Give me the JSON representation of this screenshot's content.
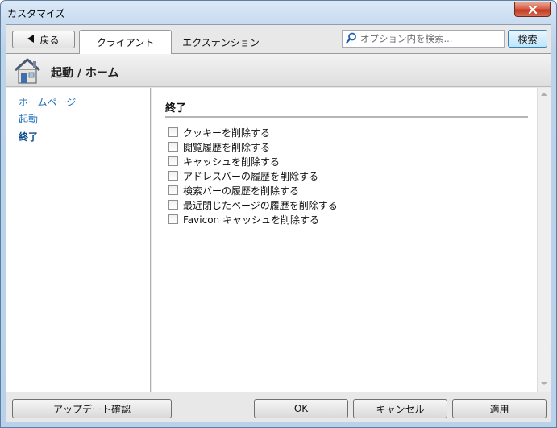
{
  "window": {
    "title": "カスタマイズ"
  },
  "toolbar": {
    "back_label": "戻る",
    "tabs": [
      {
        "label": "クライアント",
        "active": true
      },
      {
        "label": "エクステンション",
        "active": false
      }
    ],
    "search_placeholder": "オプション内を検索...",
    "search_button": "検索"
  },
  "header": {
    "title": "起動 / ホーム",
    "icon": "home-icon"
  },
  "sidebar": {
    "items": [
      {
        "label": "ホームページ",
        "active": false
      },
      {
        "label": "起動",
        "active": false
      },
      {
        "label": "終了",
        "active": true
      }
    ]
  },
  "content": {
    "section_title": "終了",
    "checkboxes": [
      {
        "label": "クッキーを削除する",
        "checked": false
      },
      {
        "label": "閲覧履歴を削除する",
        "checked": false
      },
      {
        "label": "キャッシュを削除する",
        "checked": false
      },
      {
        "label": "アドレスバーの履歴を削除する",
        "checked": false
      },
      {
        "label": "検索バーの履歴を削除する",
        "checked": false
      },
      {
        "label": "最近閉じたページの履歴を削除する",
        "checked": false
      },
      {
        "label": "Favicon キャッシュを削除する",
        "checked": false
      }
    ]
  },
  "footer": {
    "update_check": "アップデート確認",
    "ok": "OK",
    "cancel": "キャンセル",
    "apply": "適用"
  },
  "colors": {
    "link": "#1e6fb8",
    "close_button": "#c2371c",
    "accent_button": "#3c7fb1"
  }
}
